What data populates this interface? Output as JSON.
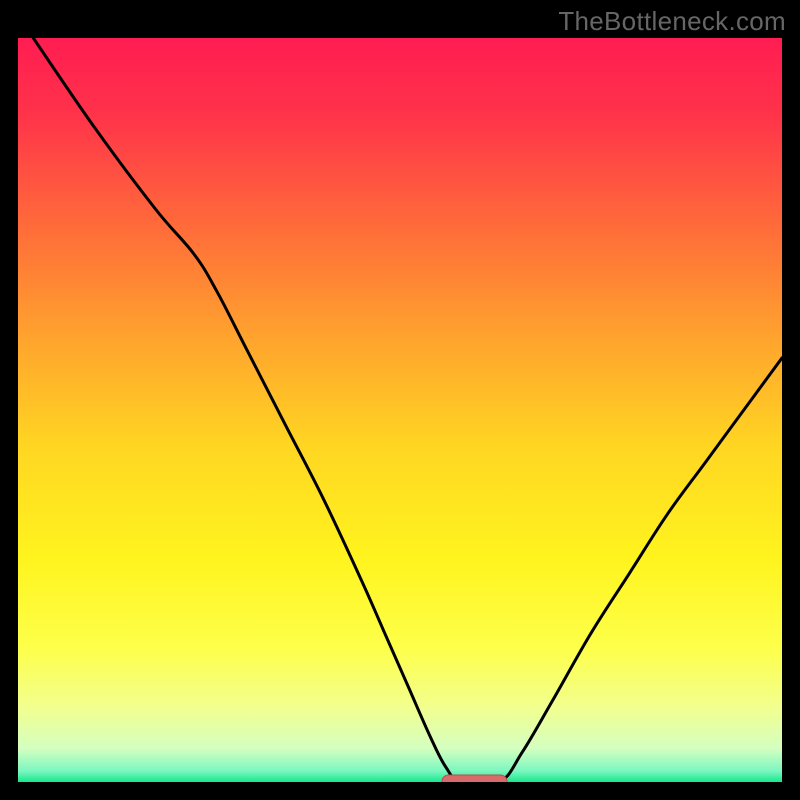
{
  "watermark": "TheBottleneck.com",
  "colors": {
    "frame": "#000000",
    "curve": "#000000",
    "marker_fill": "#d86a6a",
    "marker_stroke": "#b65050",
    "gradient_stops": [
      {
        "offset": 0.0,
        "color": "#ff1d52"
      },
      {
        "offset": 0.1,
        "color": "#ff324a"
      },
      {
        "offset": 0.25,
        "color": "#ff6a3a"
      },
      {
        "offset": 0.4,
        "color": "#ffa22e"
      },
      {
        "offset": 0.55,
        "color": "#ffd622"
      },
      {
        "offset": 0.7,
        "color": "#fff41e"
      },
      {
        "offset": 0.82,
        "color": "#fdff4a"
      },
      {
        "offset": 0.9,
        "color": "#f2ff8f"
      },
      {
        "offset": 0.955,
        "color": "#d4ffc0"
      },
      {
        "offset": 0.985,
        "color": "#7cf7c0"
      },
      {
        "offset": 1.0,
        "color": "#17e88c"
      }
    ]
  },
  "chart_data": {
    "type": "line",
    "title": "",
    "xlabel": "",
    "ylabel": "",
    "xlim": [
      0,
      100
    ],
    "ylim": [
      0,
      100
    ],
    "series": [
      {
        "name": "bottleneck-curve",
        "x": [
          2,
          10,
          18,
          23,
          26,
          30,
          35,
          40,
          45,
          48,
          51,
          54,
          56,
          58,
          63,
          66,
          70,
          75,
          80,
          85,
          90,
          95,
          100
        ],
        "values": [
          100,
          88,
          77,
          71,
          66,
          58,
          48,
          38,
          27,
          20,
          13,
          6,
          2,
          0,
          0,
          4,
          11,
          20,
          28,
          36,
          43,
          50,
          57
        ]
      }
    ],
    "optimum_marker": {
      "x_start": 55.5,
      "x_end": 64,
      "y": 0
    }
  }
}
